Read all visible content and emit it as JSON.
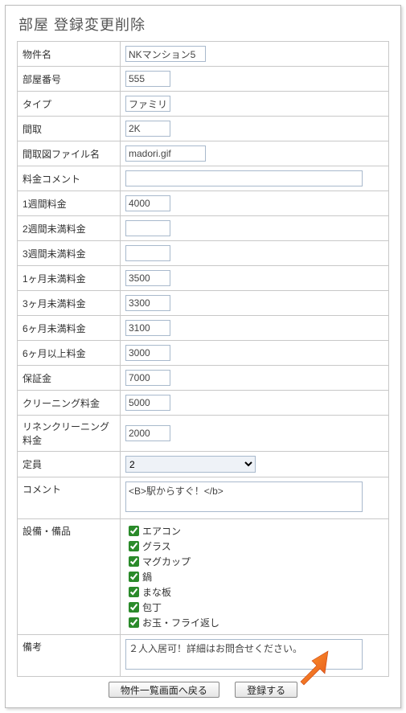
{
  "title": "部屋 登録変更削除",
  "labels": {
    "property_name": "物件名",
    "room_number": "部屋番号",
    "type": "タイプ",
    "layout": "間取",
    "layout_file": "間取図ファイル名",
    "fee_comment": "料金コメント",
    "rate_1week": "1週間料金",
    "rate_lt2w": "2週間未満料金",
    "rate_lt3w": "3週間未満料金",
    "rate_lt1m": "1ヶ月未満料金",
    "rate_lt3m": "3ヶ月未満料金",
    "rate_lt6m": "6ヶ月未満料金",
    "rate_gt6m": "6ヶ月以上料金",
    "deposit": "保証金",
    "cleaning": "クリーニング料金",
    "linen": "リネンクリーニング料金",
    "capacity": "定員",
    "comment": "コメント",
    "equipment": "設備・備品",
    "remarks": "備考"
  },
  "values": {
    "property_name": "NKマンション5",
    "room_number": "555",
    "type": "ファミリー",
    "layout": "2K",
    "layout_file": "madori.gif",
    "fee_comment": "",
    "rate_1week": "4000",
    "rate_lt2w": "",
    "rate_lt3w": "",
    "rate_lt1m": "3500",
    "rate_lt3m": "3300",
    "rate_lt6m": "3100",
    "rate_gt6m": "3000",
    "deposit": "7000",
    "cleaning": "5000",
    "linen": "2000",
    "capacity": "2",
    "comment": "<B>駅からすぐ！</b>",
    "remarks": "２人入居可！詳細はお問合せください。"
  },
  "equipment_items": [
    "エアコン",
    "グラス",
    "マグカップ",
    "鍋",
    "まな板",
    "包丁",
    "お玉・フライ返し"
  ],
  "buttons": {
    "back": "物件一覧画面へ戻る",
    "submit": "登録する"
  }
}
